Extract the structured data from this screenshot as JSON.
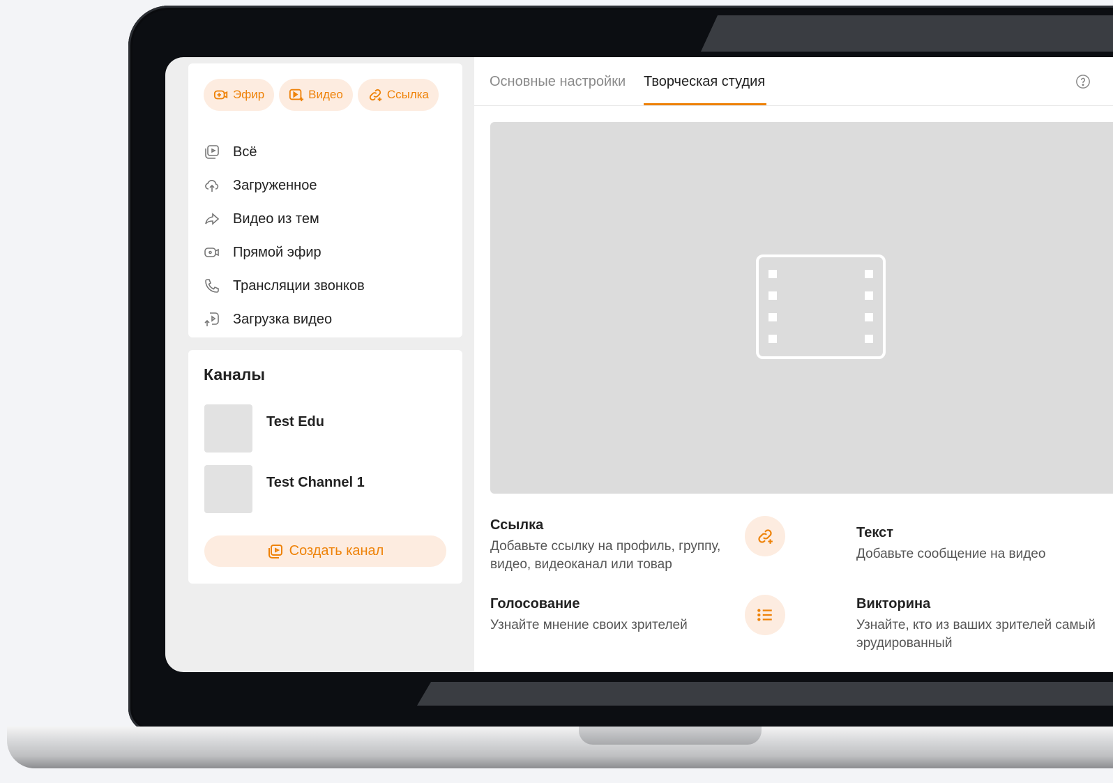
{
  "sidebar": {
    "quick_actions": [
      {
        "label": "Эфир",
        "icon": "live-camera-plus-icon"
      },
      {
        "label": "Видео",
        "icon": "video-plus-icon"
      },
      {
        "label": "Ссылка",
        "icon": "link-plus-icon"
      }
    ],
    "nav": [
      {
        "label": "Всё",
        "icon": "stack-play-icon"
      },
      {
        "label": "Загруженное",
        "icon": "cloud-upload-icon"
      },
      {
        "label": "Видео из тем",
        "icon": "share-arrow-icon"
      },
      {
        "label": "Прямой эфир",
        "icon": "live-camera-icon"
      },
      {
        "label": "Трансляции звонков",
        "icon": "phone-icon"
      },
      {
        "label": "Загрузка видео",
        "icon": "upload-video-icon"
      }
    ],
    "channels": {
      "title": "Каналы",
      "items": [
        {
          "name": "Test Edu"
        },
        {
          "name": "Test Channel 1"
        }
      ],
      "create_label": "Создать канал"
    }
  },
  "tabs": [
    {
      "label": "Основные настройки",
      "active": false
    },
    {
      "label": "Творческая студия",
      "active": true
    }
  ],
  "tools": [
    {
      "title": "Ссылка",
      "description": "Добавьте ссылку на профиль, группу, видео, видеоканал или товар",
      "icon": "link-plus-icon"
    },
    {
      "title": "Текст",
      "description": "Добавьте сообщение на видео"
    },
    {
      "title": "Голосование",
      "description": "Узнайте мнение своих зрителей",
      "icon": "list-icon"
    },
    {
      "title": "Викторина",
      "description": "Узнайте, кто из ваших зрителей самый эрудированный"
    }
  ],
  "colors": {
    "accent": "#ee8208",
    "accent_bg": "#fdece0",
    "preview_bg": "#dcdcdc"
  }
}
